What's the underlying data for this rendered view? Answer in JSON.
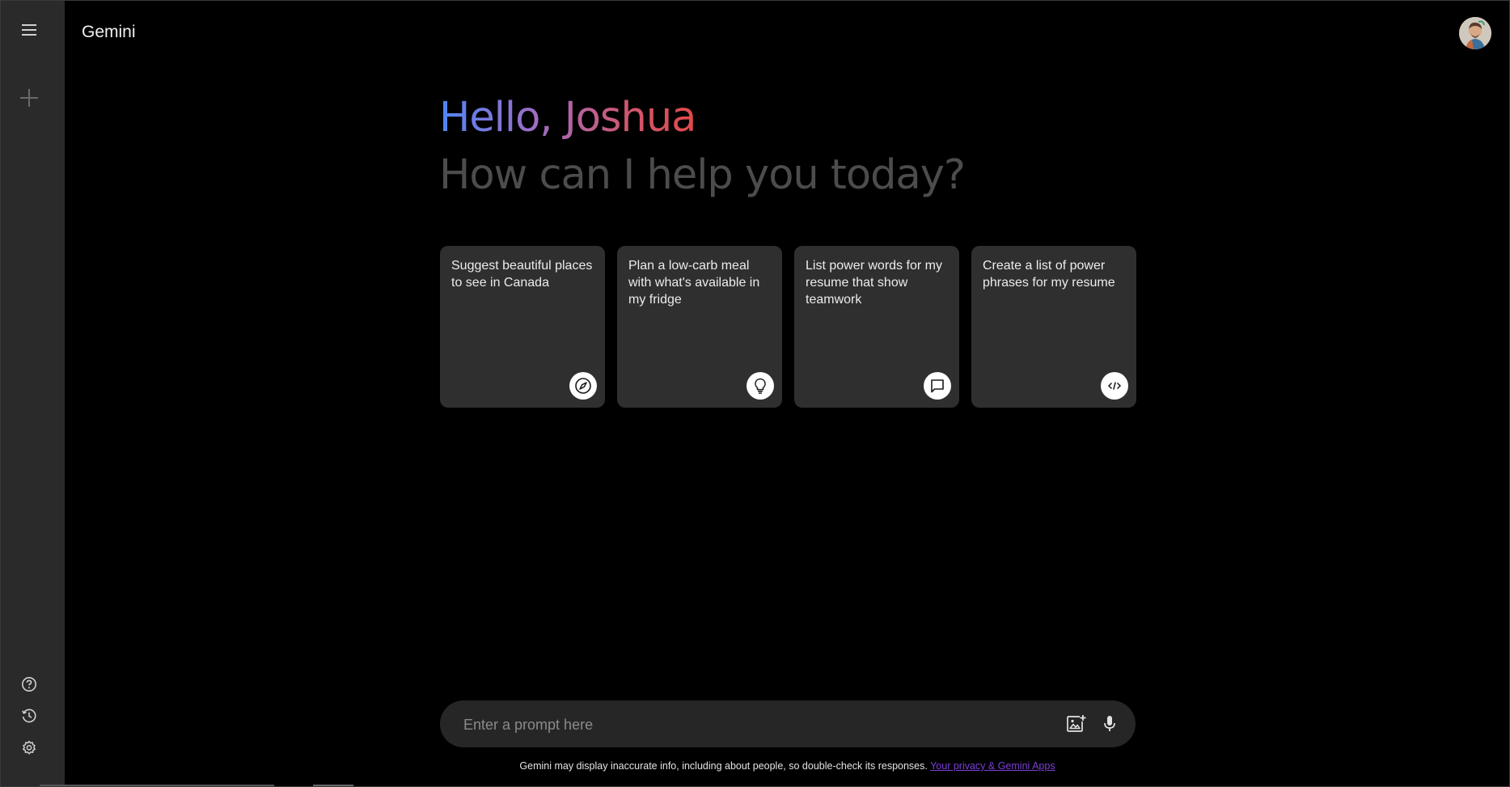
{
  "app": {
    "brand": "Gemini"
  },
  "greeting": {
    "hello": "Hello, Joshua",
    "subtitle": "How can I help you today?"
  },
  "cards": [
    {
      "text": "Suggest beautiful places to see in Canada",
      "icon": "compass-icon"
    },
    {
      "text": "Plan a low-carb meal with what's available in my fridge",
      "icon": "lightbulb-icon"
    },
    {
      "text": "List power words for my resume that show teamwork",
      "icon": "chat-bubble-icon"
    },
    {
      "text": "Create a list of power phrases for my resume",
      "icon": "code-icon"
    }
  ],
  "prompt": {
    "placeholder": "Enter a prompt here",
    "value": ""
  },
  "footer": {
    "disclaimer": "Gemini may display inaccurate info, including about people, so double-check its responses. ",
    "privacy_link": "Your privacy & Gemini Apps"
  },
  "colors": {
    "sidebar_bg": "#2a2a2a",
    "card_bg": "#2f2f2f",
    "prompt_bg": "#262626",
    "gradient_start": "#4f86f7",
    "gradient_end": "#e04a4a",
    "link": "#7b3ed6"
  }
}
